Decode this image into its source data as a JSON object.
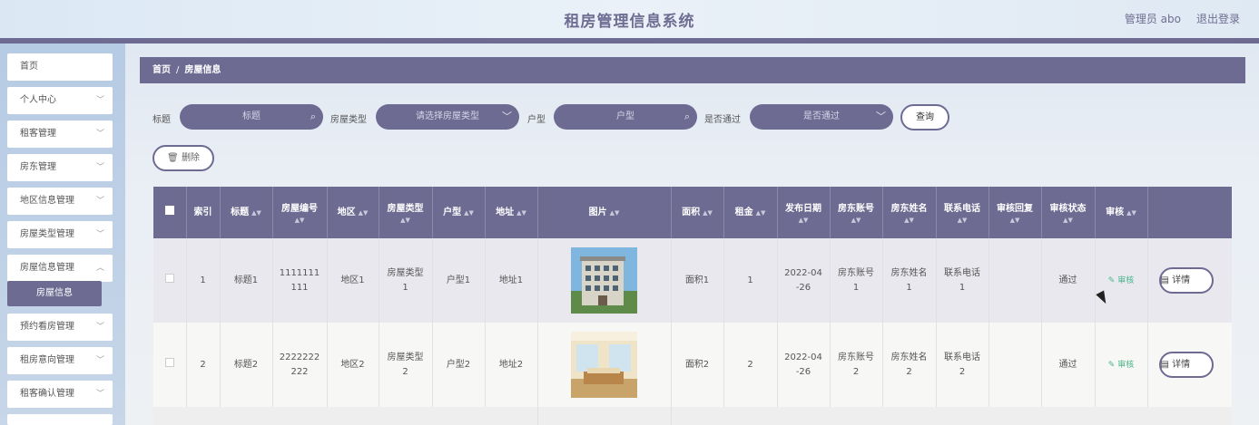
{
  "header": {
    "title": "租房管理信息系统",
    "user": "管理员 abo",
    "logout": "退出登录"
  },
  "sidebar": {
    "items": [
      {
        "label": "首页"
      },
      {
        "label": "个人中心"
      },
      {
        "label": "租客管理"
      },
      {
        "label": "房东管理"
      },
      {
        "label": "地区信息管理"
      },
      {
        "label": "房屋类型管理"
      },
      {
        "label": "房屋信息管理"
      },
      {
        "label": "预约看房管理"
      },
      {
        "label": "租房意向管理"
      },
      {
        "label": "租客确认管理"
      }
    ],
    "active_sub": "房屋信息"
  },
  "breadcrumb": {
    "home": "首页",
    "current": "房屋信息"
  },
  "filters": {
    "title_label": "标题",
    "title_placeholder": "标题",
    "type_label": "房屋类型",
    "type_placeholder": "请选择房屋类型",
    "layout_label": "户型",
    "layout_placeholder": "户型",
    "pass_label": "是否通过",
    "pass_placeholder": "是否通过",
    "query": "查询"
  },
  "actions": {
    "delete": "删除"
  },
  "table": {
    "headers": [
      "索引",
      "标题",
      "房屋编号",
      "地区",
      "房屋类型",
      "户型",
      "地址",
      "图片",
      "面积",
      "租金",
      "发布日期",
      "房东账号",
      "房东姓名",
      "联系电话",
      "审核回复",
      "审核状态",
      "审核"
    ],
    "review_label": "审核",
    "detail_label": "详情",
    "rows": [
      {
        "index": "1",
        "title": "标题1",
        "code1": "1111111",
        "code2": "111",
        "region": "地区1",
        "type1": "房屋类型",
        "type2": "1",
        "layout": "户型1",
        "address": "地址1",
        "area": "面积1",
        "rent": "1",
        "date1": "2022-04",
        "date2": "-26",
        "acct1": "房东账号",
        "acct2": "1",
        "name1": "房东姓名",
        "name2": "1",
        "phone1": "联系电话",
        "phone2": "1",
        "reply": "",
        "status": "通过"
      },
      {
        "index": "2",
        "title": "标题2",
        "code1": "2222222",
        "code2": "222",
        "region": "地区2",
        "type1": "房屋类型",
        "type2": "2",
        "layout": "户型2",
        "address": "地址2",
        "area": "面积2",
        "rent": "2",
        "date1": "2022-04",
        "date2": "-26",
        "acct1": "房东账号",
        "acct2": "2",
        "name1": "房东姓名",
        "name2": "2",
        "phone1": "联系电话",
        "phone2": "2",
        "reply": "",
        "status": "通过"
      }
    ]
  },
  "colors": {
    "accent": "#6e6b92",
    "review_green": "#4ab58a"
  }
}
